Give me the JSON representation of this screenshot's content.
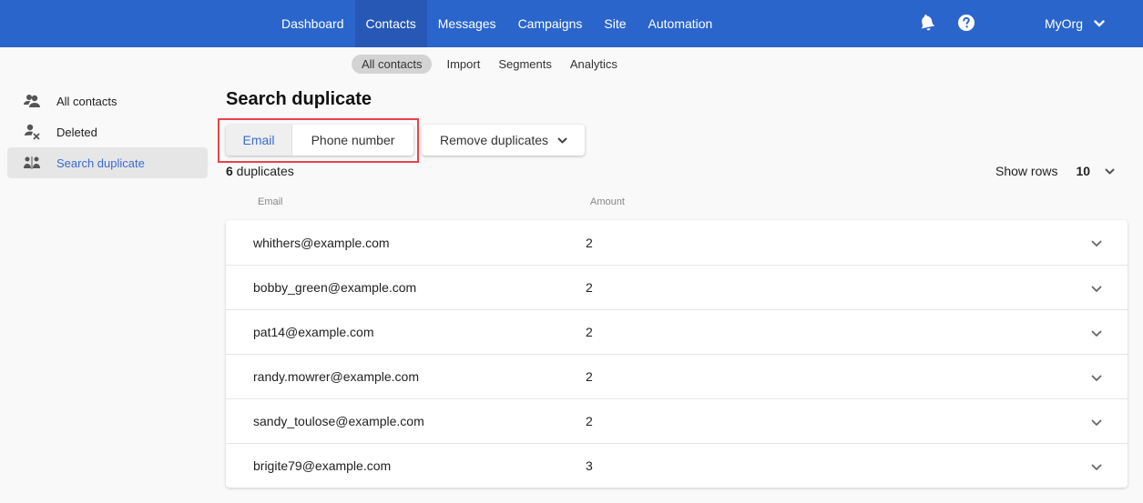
{
  "topbar": {
    "nav": [
      {
        "label": "Dashboard",
        "active": false
      },
      {
        "label": "Contacts",
        "active": true
      },
      {
        "label": "Messages",
        "active": false
      },
      {
        "label": "Campaigns",
        "active": false
      },
      {
        "label": "Site",
        "active": false
      },
      {
        "label": "Automation",
        "active": false
      }
    ],
    "icons": [
      "bell-icon",
      "help-icon"
    ],
    "org_label": "MyOrg",
    "brand_color": "#2a65cb"
  },
  "subnav": {
    "items": [
      {
        "label": "All contacts",
        "active": true
      },
      {
        "label": "Import",
        "active": false
      },
      {
        "label": "Segments",
        "active": false
      },
      {
        "label": "Analytics",
        "active": false
      }
    ]
  },
  "sidebar": {
    "items": [
      {
        "label": "All contacts",
        "icon": "users-icon",
        "active": false
      },
      {
        "label": "Deleted",
        "icon": "user-deleted-icon",
        "active": false
      },
      {
        "label": "Search duplicate",
        "icon": "duplicate-users-icon",
        "active": true
      }
    ]
  },
  "main": {
    "title": "Search duplicate",
    "toggle": {
      "email_label": "Email",
      "phone_label": "Phone number",
      "selected": "Email"
    },
    "remove_label": "Remove duplicates",
    "count_number": "6",
    "count_suffix": " duplicates",
    "show_rows_label": "Show rows",
    "show_rows_value": "10",
    "columns": {
      "email": "Email",
      "amount": "Amount"
    },
    "rows": [
      {
        "email": "whithers@example.com",
        "amount": "2"
      },
      {
        "email": "bobby_green@example.com",
        "amount": "2"
      },
      {
        "email": "pat14@example.com",
        "amount": "2"
      },
      {
        "email": "randy.mowrer@example.com",
        "amount": "2"
      },
      {
        "email": "sandy_toulose@example.com",
        "amount": "2"
      },
      {
        "email": "brigite79@example.com",
        "amount": "3"
      }
    ]
  }
}
